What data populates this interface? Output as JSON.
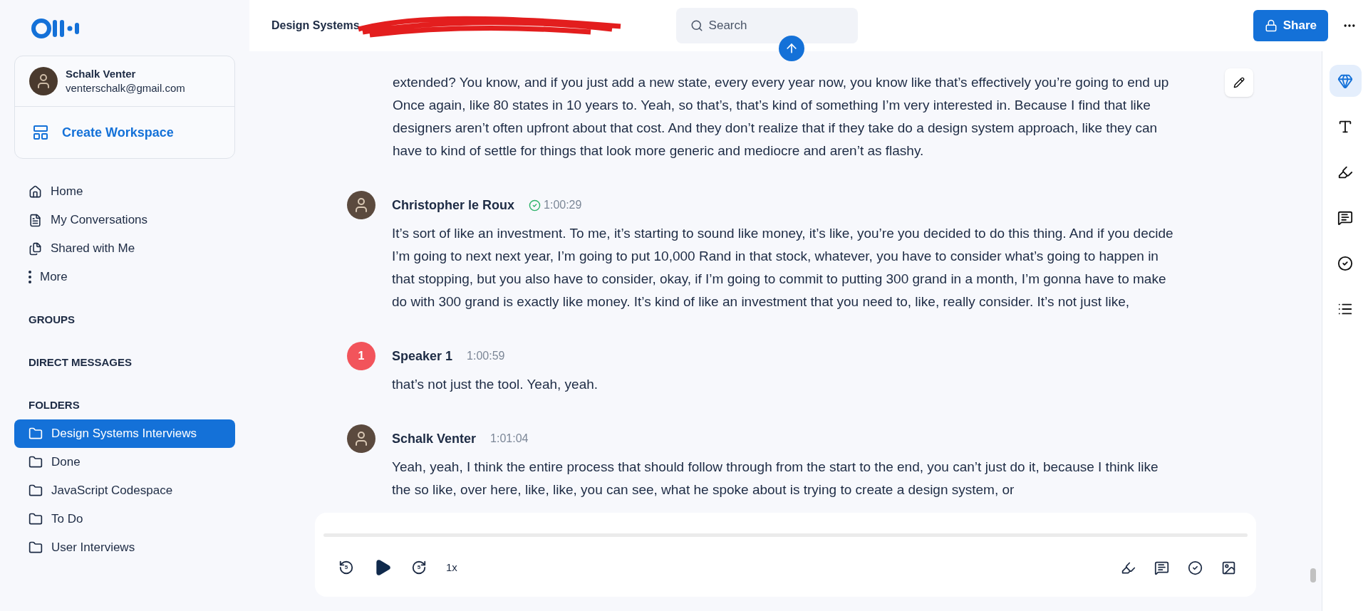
{
  "account": {
    "name": "Schalk Venter",
    "email": "venterschalk@gmail.com"
  },
  "create_workspace": "Create Workspace",
  "nav": [
    {
      "label": "Home",
      "selected": false
    },
    {
      "label": "My Conversations",
      "selected": false
    },
    {
      "label": "Shared with Me",
      "selected": false
    },
    {
      "label": "More",
      "selected": false
    }
  ],
  "sections": [
    {
      "title": "GROUPS"
    },
    {
      "title": "DIRECT MESSAGES"
    },
    {
      "title": "FOLDERS",
      "items": [
        {
          "label": "Design Systems Interviews",
          "selected": true
        },
        {
          "label": "Done",
          "selected": false
        },
        {
          "label": "JavaScript Codespace",
          "selected": false
        },
        {
          "label": "To Do",
          "selected": false
        },
        {
          "label": "User Interviews",
          "selected": false
        }
      ]
    }
  ],
  "header": {
    "title": "Design Systems",
    "search_placeholder": "Search",
    "share": "Share"
  },
  "transcript": [
    {
      "kind": "continuation",
      "text": "extended? You know, and if you just add a new state, every every year now, you know like that’s effectively you’re going to end up Once again, like 80 states in 10 years to. Yeah, so that’s, that’s kind of something I’m very interested in. Because I find that like designers aren’t often upfront about that cost. And they don’t realize that if they take do a design system approach, like they can have to kind of settle for things that look more generic and mediocre and aren’t as flashy."
    },
    {
      "kind": "photo",
      "speaker": "Christopher le Roux",
      "time": "1:00:29",
      "verified": true,
      "text": "It’s sort of like an investment. To me, it’s starting to sound like money, it’s like, you’re you decided to do this thing. And if you decide I’m going to next next year, I’m going to put 10,000 Rand in that stock, whatever, you have to consider what’s going to happen in that stopping, but you also have to consider, okay, if I’m going to commit to putting 300 grand in a month, I’m gonna have to make do with 300 grand is exactly like money. It’s kind of like an investment that you need to, like, really consider. It’s not just like,"
    },
    {
      "kind": "number",
      "badge": "1",
      "speaker": "Speaker 1",
      "time": "1:00:59",
      "verified": false,
      "text": "that’s not just the tool. Yeah, yeah."
    },
    {
      "kind": "photo",
      "speaker": "Schalk Venter",
      "time": "1:01:04",
      "verified": false,
      "text": "Yeah, yeah, I think the entire process that should follow through from the start to the end, you can’t just do it, because I think like the so like, over here, like, like, you can see, what he spoke about is trying to create a design system, or"
    }
  ],
  "player": {
    "skip_back": "5",
    "skip_forward": "5",
    "speed": "1x"
  },
  "rail": [
    {
      "selected": true
    },
    {
      "selected": false
    },
    {
      "selected": false
    },
    {
      "selected": false
    },
    {
      "selected": false
    },
    {
      "selected": false
    }
  ]
}
